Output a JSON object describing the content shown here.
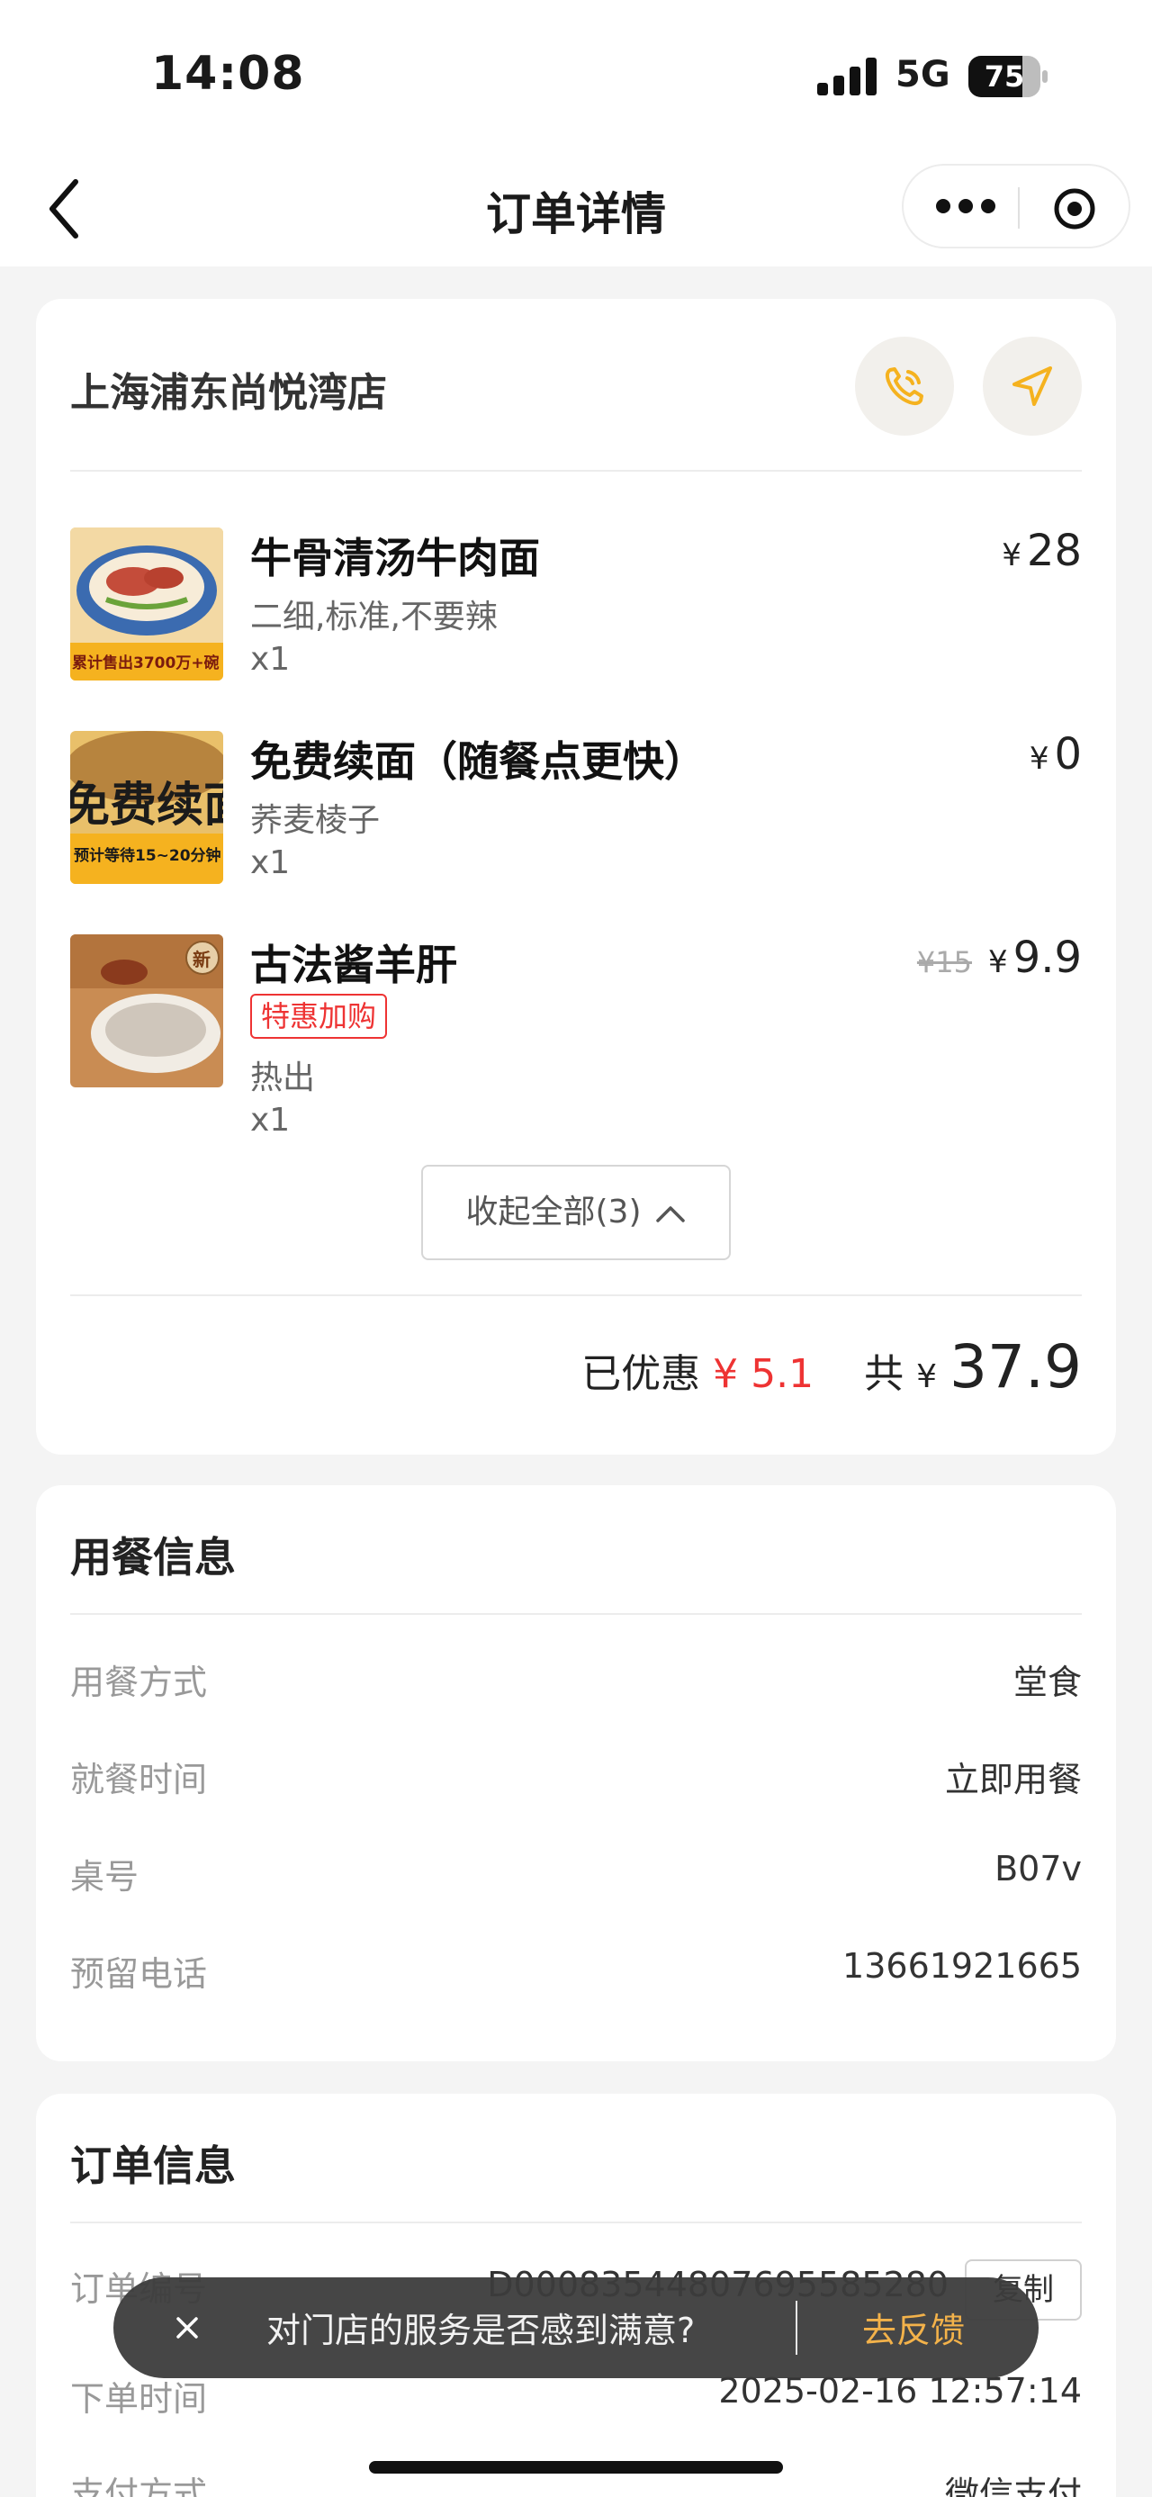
{
  "status_bar": {
    "time": "14:08",
    "network": "5G",
    "battery": "75",
    "battery_level": 0.75
  },
  "nav": {
    "title": "订单详情",
    "back_icon": "chevron-left-icon",
    "more_icon": "more-dots-icon",
    "target_icon": "target-icon"
  },
  "store": {
    "name": "上海浦东尚悦湾店",
    "phone_icon": "phone-icon",
    "navigate_icon": "navigation-arrow-icon",
    "accent_color": "#f5b21f"
  },
  "items": [
    {
      "name": "牛骨清汤牛肉面",
      "spec": "二细,标准,不要辣",
      "qty": "x1",
      "currency": "¥",
      "price": "28",
      "image_text": "累计售出3700万+碗"
    },
    {
      "name": "免费续面（随餐点更快）",
      "spec": "荞麦棱子",
      "qty": "x1",
      "currency": "¥",
      "price": "0",
      "image_text": "免费续面",
      "image_sub": "预计等待15~20分钟"
    },
    {
      "name": "古法酱羊肝",
      "tag": "特惠加购",
      "spec": "热出",
      "qty": "x1",
      "currency": "¥",
      "price": "9.9",
      "original_price": "¥15",
      "image_badge": "新"
    }
  ],
  "collapse_label": "收起全部(3)",
  "summary": {
    "discount_label": "已优惠",
    "discount_value": "¥ 5.1",
    "total_label": "共",
    "currency": "¥",
    "total_value": "37.9"
  },
  "dining": {
    "title": "用餐信息",
    "rows": [
      {
        "label": "用餐方式",
        "value": "堂食"
      },
      {
        "label": "就餐时间",
        "value": "立即用餐"
      },
      {
        "label": "桌号",
        "value": "B07v"
      },
      {
        "label": "预留电话",
        "value": "13661921665"
      }
    ]
  },
  "order": {
    "title": "订单信息",
    "rows": [
      {
        "label": "订单编号",
        "value": "D0008354480769558528​0"
      },
      {
        "label": "下单时间",
        "value": "2025-02-16 12:57:14"
      },
      {
        "label": "支付方式",
        "value": "微信支付"
      }
    ],
    "copy_label": "复制"
  },
  "toast": {
    "message": "对门店的服务是否感到满意?",
    "action": "去反馈",
    "close_icon": "close-icon",
    "action_color": "#f3b24a"
  }
}
